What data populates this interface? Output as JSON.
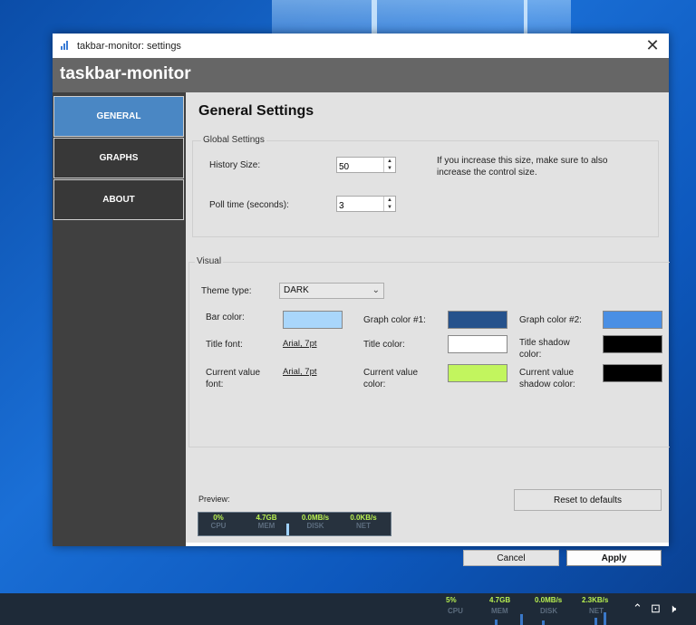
{
  "window": {
    "title": "takbar-monitor: settings",
    "app_name": "taskbar-monitor",
    "close_glyph": "✕"
  },
  "sidebar": {
    "items": [
      {
        "label": "GENERAL",
        "active": true
      },
      {
        "label": "GRAPHS",
        "active": false
      },
      {
        "label": "ABOUT",
        "active": false
      }
    ]
  },
  "general": {
    "page_title": "General Settings",
    "global": {
      "group_label": "Global Settings",
      "history_label": "History Size:",
      "history_value": "50",
      "poll_label": "Poll time (seconds):",
      "poll_value": "3",
      "hint": "If you increase this size, make sure to also increase the control size."
    },
    "visual": {
      "group_label": "Visual",
      "theme_label": "Theme type:",
      "theme_value": "DARK",
      "bar_color_label": "Bar color:",
      "bar_color": "#a9d6fb",
      "graph1_label": "Graph color #1:",
      "graph1_color": "#26528c",
      "graph2_label": "Graph color #2:",
      "graph2_color": "#4a8fe4",
      "title_font_label": "Title font:",
      "title_font_value": "Arial, 7pt",
      "title_color_label": "Title color:",
      "title_color": "#ffffff",
      "title_shadow_label": "Title shadow color:",
      "title_shadow_color": "#000000",
      "current_font_label": "Current value font:",
      "current_font_value": "Arial, 7pt",
      "current_color_label": "Current value color:",
      "current_color": "#c2f55e",
      "current_shadow_label": "Current value shadow color:",
      "current_shadow_color": "#000000"
    },
    "preview": {
      "label": "Preview:",
      "cells": [
        {
          "value": "0%",
          "name": "CPU"
        },
        {
          "value": "4.7GB",
          "name": "MEM"
        },
        {
          "value": "0.0MB/s",
          "name": "DISK"
        },
        {
          "value": "0.0KB/s",
          "name": "NET"
        }
      ]
    },
    "buttons": {
      "reset": "Reset to defaults",
      "cancel": "Cancel",
      "apply": "Apply"
    }
  },
  "taskbar": {
    "monitor": [
      {
        "value": "5%",
        "name": "CPU"
      },
      {
        "value": "4.7GB",
        "name": "MEM"
      },
      {
        "value": "0.0MB/s",
        "name": "DISK"
      },
      {
        "value": "2.3KB/s",
        "name": "NET"
      }
    ],
    "tray_icons": [
      "chevron-up-icon",
      "network-icon",
      "speaker-muted-icon"
    ]
  }
}
